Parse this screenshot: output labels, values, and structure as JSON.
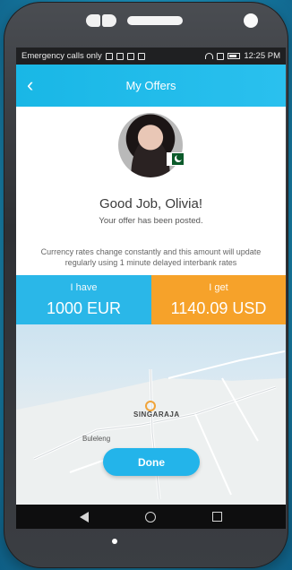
{
  "status_bar": {
    "left_text": "Emergency calls only",
    "right_text": "12:25 PM"
  },
  "app_bar": {
    "title": "My Offers",
    "back_icon": "‹"
  },
  "profile": {
    "headline": "Good Job, Olivia!",
    "subline": "Your offer has been posted."
  },
  "info": {
    "text": "Currency rates change constantly and this amount will update regularly using 1 minute delayed interbank rates"
  },
  "exchange": {
    "have_label": "I have",
    "have_value": "1000 EUR",
    "get_label": "I get",
    "get_value": "1140.09 USD",
    "have_color": "#2ab7e8",
    "get_color": "#f6a22a"
  },
  "map": {
    "city_label": "SINGARAJA",
    "area_label": "Buleleng"
  },
  "actions": {
    "done_label": "Done"
  }
}
